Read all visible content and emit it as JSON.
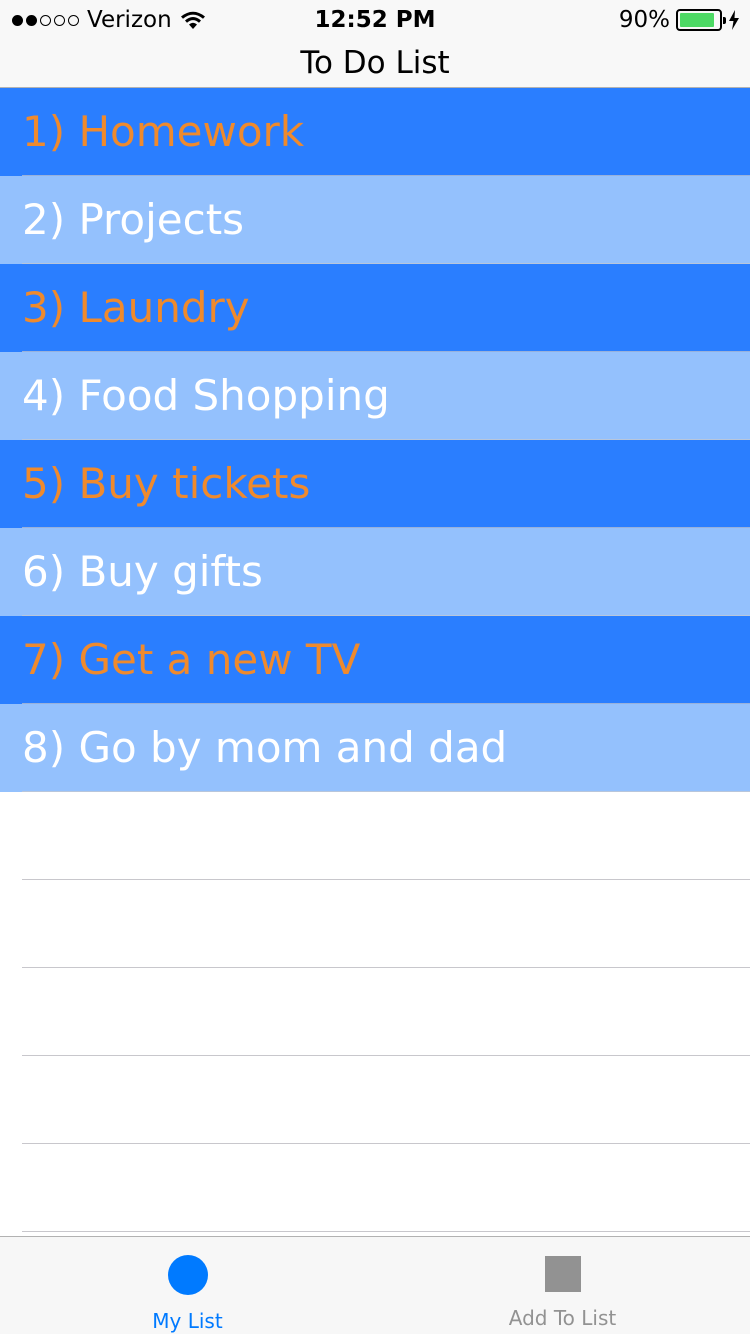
{
  "status_bar": {
    "carrier": "Verizon",
    "time": "12:52 PM",
    "battery_percent": "90%",
    "battery_level": 0.9,
    "signal_bars_filled": 2,
    "signal_bars_total": 5
  },
  "nav": {
    "title": "To Do List"
  },
  "todo_items": [
    {
      "label": "1) Homework"
    },
    {
      "label": "2) Projects"
    },
    {
      "label": "3) Laundry"
    },
    {
      "label": "4) Food Shopping"
    },
    {
      "label": "5) Buy tickets"
    },
    {
      "label": "6) Buy gifts"
    },
    {
      "label": "7) Get a new TV"
    },
    {
      "label": "8) Go by mom and dad"
    }
  ],
  "tab_bar": {
    "tabs": [
      {
        "label": "My List",
        "icon": "circle-icon",
        "active": true
      },
      {
        "label": "Add To List",
        "icon": "square-icon",
        "active": false
      }
    ]
  },
  "colors": {
    "dark_row_bg": "#2a7eff",
    "dark_row_text": "#ef8a2d",
    "light_row_bg": "#94c1fd",
    "light_row_text": "#ffffff",
    "tab_active": "#007aff",
    "tab_inactive": "#929292"
  }
}
